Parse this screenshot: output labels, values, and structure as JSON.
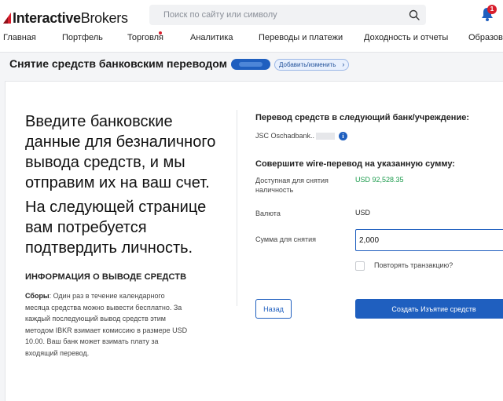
{
  "header": {
    "logo_text_prefix": "Interactive",
    "logo_text_suffix": "Brokers",
    "search_placeholder": "Поиск по сайту или символу",
    "notification_count": "1"
  },
  "nav": [
    {
      "label": "Главная"
    },
    {
      "label": "Портфель"
    },
    {
      "label": "Торговля"
    },
    {
      "label": "Аналитика"
    },
    {
      "label": "Переводы и платежи"
    },
    {
      "label": "Доходность и отчеты"
    },
    {
      "label": "Образова"
    }
  ],
  "subheader": {
    "title": "Снятие средств банковским переводом",
    "add_change_label": "Добавить/изменить"
  },
  "left": {
    "headline": "Введите банковские данные для безналичного вывода средств, и мы отправим их на ваш счет.",
    "headline2": "На следующей странице вам потребуется подтвердить личность.",
    "info_title": "ИНФОРМАЦИЯ О ВЫВОДЕ СРЕДСТВ",
    "fees_label": "Сборы",
    "fees_text": ": Один раз в течение календарного месяца средства можно вывести бесплатно. За каждый последующий вывод средств этим методом IBKR взимает комиссию в размере USD 10.00. Ваш банк может взимать плату за входящий перевод."
  },
  "right": {
    "transfer_to_title": "Перевод средств в следующий банк/учреждение:",
    "bank_name": "JSC Oschadbank..",
    "wire_title": "Совершите wire-перевод на указанную сумму:",
    "available_label": "Доступная для снятия наличность",
    "available_value": "USD 92,528.35",
    "currency_label": "Валюта",
    "currency_value": "USD",
    "amount_label": "Сумма для снятия",
    "amount_value": "2,000",
    "repeat_label": "Повторять транзакцию?",
    "back_label": "Назад",
    "submit_label": "Создать Изъятие средств"
  },
  "colors": {
    "accent": "#1f5fbf",
    "positive": "#1a9a4b",
    "badge": "#d81e2c"
  }
}
